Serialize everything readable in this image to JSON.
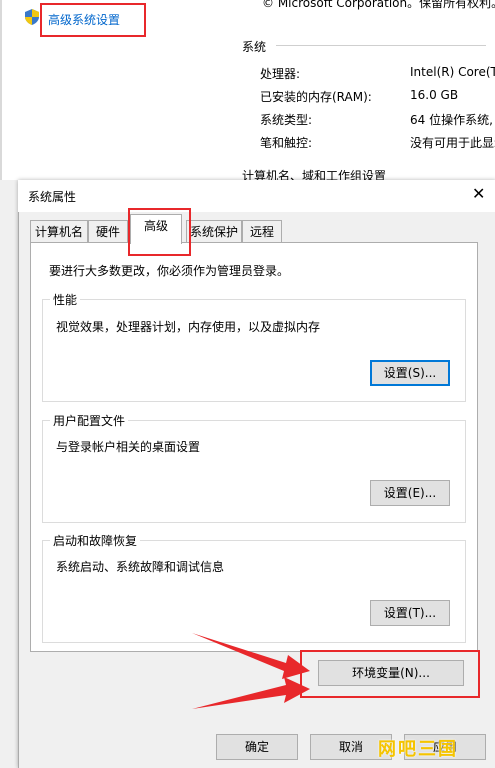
{
  "background_window": {
    "advanced_link": "高级系统设置",
    "copyright": "© Microsoft Corporation。保留所有权利。",
    "system_heading": "系统",
    "rows": [
      {
        "label": "处理器:",
        "value": "Intel(R) Core(TM"
      },
      {
        "label": "已安装的内存(RAM):",
        "value": "16.0 GB"
      },
      {
        "label": "系统类型:",
        "value": "64 位操作系统,"
      },
      {
        "label": "笔和触控:",
        "value": "没有可用于此显示"
      }
    ],
    "computer_name_heading": "计算机名、域和工作组设置"
  },
  "dialog": {
    "title": "系统属性",
    "close_glyph": "✕",
    "tabs": [
      "计算机名",
      "硬件",
      "高级",
      "系统保护",
      "远程"
    ],
    "admin_note": "要进行大多数更改，你必须作为管理员登录。",
    "performance": {
      "title": "性能",
      "description": "视觉效果，处理器计划，内存使用，以及虚拟内存",
      "button": "设置(S)..."
    },
    "user_profiles": {
      "title": "用户配置文件",
      "description": "与登录帐户相关的桌面设置",
      "button": "设置(E)..."
    },
    "startup_recovery": {
      "title": "启动和故障恢复",
      "description": "系统启动、系统故障和调试信息",
      "button": "设置(T)..."
    },
    "env_button": "环境变量(N)...",
    "ok_button": "确定",
    "cancel_button": "取消",
    "apply_button": "应用"
  },
  "watermark": "网吧三国",
  "colors": {
    "link": "#0066cc",
    "highlight_red": "#e8282b",
    "focus_blue": "#0078d7"
  }
}
